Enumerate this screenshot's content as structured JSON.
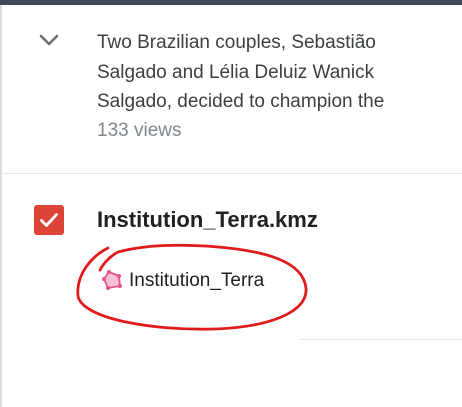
{
  "description": {
    "text": "Two Brazilian couples, Sebastião Salgado and Lélia Deluiz Wanick Salgado, decided to champion the",
    "views": "133 views",
    "chevron_icon": "chevron-down-icon"
  },
  "layer": {
    "checked": true,
    "checkbox_color": "#db4437",
    "title": "Institution_Terra.kmz",
    "items": [
      {
        "label": "Institution_Terra",
        "icon": "polygon-icon",
        "icon_color": "#e8548a"
      }
    ]
  },
  "annotation": {
    "shape": "hand-drawn ellipse",
    "color": "#e01b1b"
  }
}
